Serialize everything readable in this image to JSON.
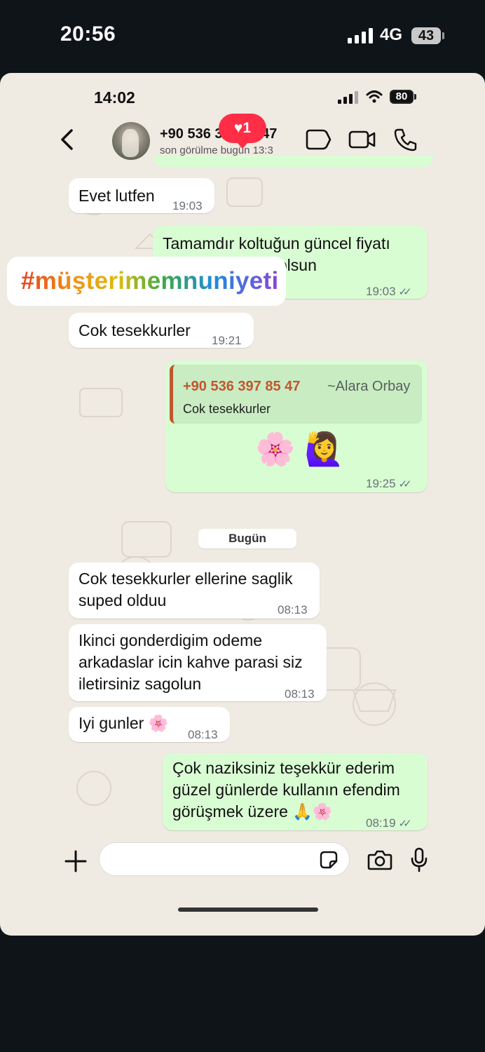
{
  "outer_status": {
    "time": "20:56",
    "network": "4G",
    "battery": "43"
  },
  "inner_status": {
    "time": "14:02",
    "battery": "80"
  },
  "header": {
    "contact_name": "+90 536 397 85 47",
    "last_seen": "son görülme bugün 13:3",
    "like_count": "♥1",
    "icons": [
      "back-chevron-icon",
      "label-icon",
      "video-call-icon",
      "phone-icon"
    ]
  },
  "hashtag": "#müşterimemnuniyeti",
  "messages": [
    {
      "dir": "in",
      "text": "Evet lutfen",
      "time": "19:03"
    },
    {
      "dir": "out",
      "text": "Tamamdır koltuğun güncel fiyatı\n       dim bilginiz olsun",
      "time": "19:03"
    },
    {
      "dir": "in",
      "text": "Cok tesekkurler",
      "time": "19:21"
    },
    {
      "dir": "out",
      "quote_phone": "+90 536 397 85 47",
      "quote_sender": "~Alara Orbay",
      "quote_text": "Cok tesekkurler",
      "text": "🌸 🙋‍♀️",
      "time": "19:25"
    },
    {
      "dir": "in",
      "text": "Cok tesekkurler ellerine saglik\nsuped olduu",
      "time": "08:13"
    },
    {
      "dir": "in",
      "text": "Ikinci gonderdigim odeme\narkadaslar icin kahve parasi siz\niletirsiniz sagolun",
      "time": "08:13"
    },
    {
      "dir": "in",
      "text": "Iyi gunler 🌸",
      "time": "08:13"
    },
    {
      "dir": "out",
      "text": "Çok naziksiniz teşekkür ederim\ngüzel günlerde kullanın efendim\ngörüşmek üzere 🙏🌸",
      "time": "08:19"
    }
  ],
  "day_separator": "Bugün",
  "ticks": "✓✓",
  "colors": {
    "outgoing": "#d9fdd3",
    "incoming": "#ffffff",
    "background": "#efeae2",
    "badge": "#ff2d46",
    "quote_accent": "#c1562e"
  }
}
